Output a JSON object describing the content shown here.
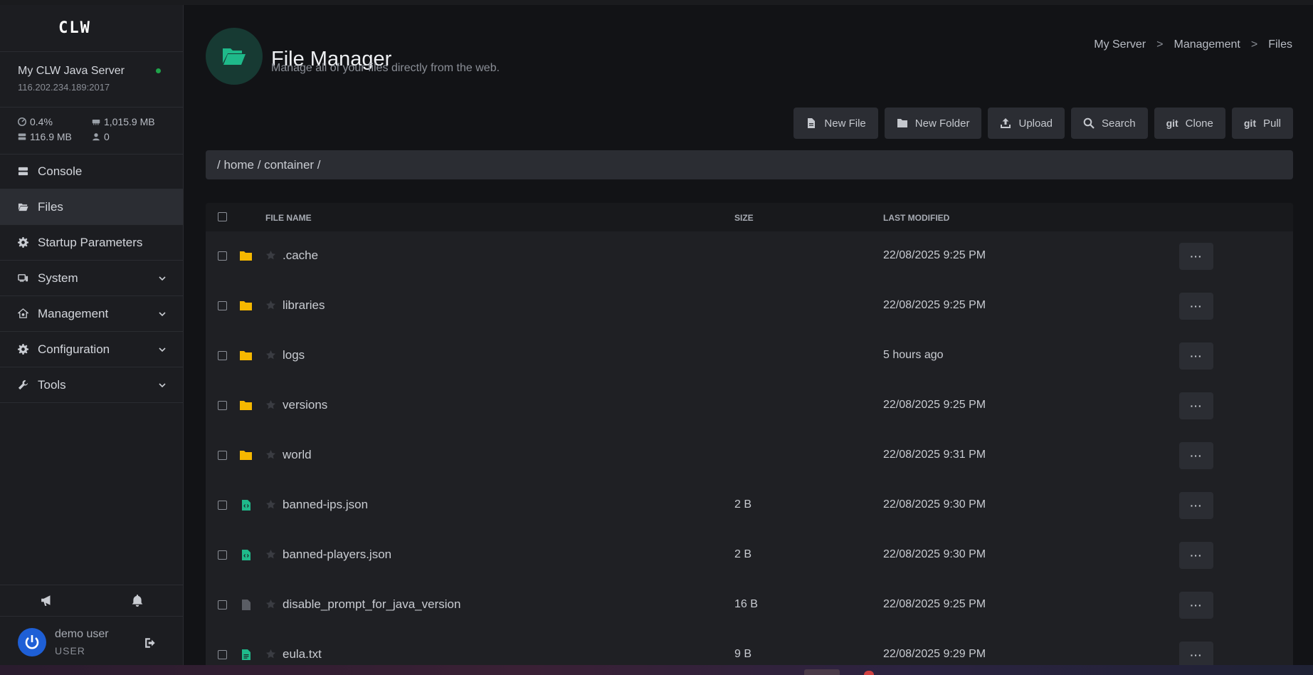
{
  "sidebar": {
    "logo": "CLW",
    "server": {
      "name": "My CLW Java Server",
      "ip": "116.202.234.189:2017",
      "online": true
    },
    "stats": {
      "cpu": "0.4%",
      "memory": "1,015.9 MB",
      "disk": "116.9 MB",
      "players": "0"
    },
    "nav": [
      {
        "label": "Console",
        "icon": "console-icon",
        "active": false
      },
      {
        "label": "Files",
        "icon": "folder-icon",
        "active": true
      },
      {
        "label": "Startup Parameters",
        "icon": "gear-icon",
        "active": false
      },
      {
        "label": "System",
        "icon": "system-icon",
        "active": false,
        "expandable": true
      },
      {
        "label": "Management",
        "icon": "management-icon",
        "active": false,
        "expandable": true
      },
      {
        "label": "Configuration",
        "icon": "gear-icon",
        "active": false,
        "expandable": true
      },
      {
        "label": "Tools",
        "icon": "wrench-icon",
        "active": false,
        "expandable": true
      }
    ],
    "footer": {
      "announcements_icon": "megaphone-icon",
      "notifications_icon": "bell-icon"
    },
    "user": {
      "name": "demo user",
      "role": "USER"
    }
  },
  "header": {
    "title": "File Manager",
    "subtitle": "Manage all of your files directly from the web.",
    "breadcrumb": [
      "My Server",
      "Management",
      "Files"
    ],
    "breadcrumb_sep": ">"
  },
  "toolbar": {
    "new_file": "New File",
    "new_folder": "New Folder",
    "upload": "Upload",
    "search": "Search",
    "clone": "Clone",
    "pull": "Pull",
    "git_label": "git"
  },
  "path": "/ home / container /",
  "table": {
    "columns": {
      "name": "FILE NAME",
      "size": "SIZE",
      "modified": "LAST MODIFIED"
    },
    "rows": [
      {
        "name": ".cache",
        "type": "folder",
        "size": "",
        "modified": "22/08/2025 9:25 PM"
      },
      {
        "name": "libraries",
        "type": "folder",
        "size": "",
        "modified": "22/08/2025 9:25 PM"
      },
      {
        "name": "logs",
        "type": "folder",
        "size": "",
        "modified": "5 hours ago"
      },
      {
        "name": "versions",
        "type": "folder",
        "size": "",
        "modified": "22/08/2025 9:25 PM"
      },
      {
        "name": "world",
        "type": "folder",
        "size": "",
        "modified": "22/08/2025 9:31 PM"
      },
      {
        "name": "banned-ips.json",
        "type": "code",
        "size": "2 B",
        "modified": "22/08/2025 9:30 PM"
      },
      {
        "name": "banned-players.json",
        "type": "code",
        "size": "2 B",
        "modified": "22/08/2025 9:30 PM"
      },
      {
        "name": "disable_prompt_for_java_version",
        "type": "file",
        "size": "16 B",
        "modified": "22/08/2025 9:25 PM"
      },
      {
        "name": "eula.txt",
        "type": "text",
        "size": "9 B",
        "modified": "22/08/2025 9:29 PM"
      }
    ],
    "more_label": "···"
  },
  "colors": {
    "accent": "#1fb98a",
    "folder": "#f5b800",
    "online": "#1fa34a",
    "avatar": "#1e5fd6"
  }
}
